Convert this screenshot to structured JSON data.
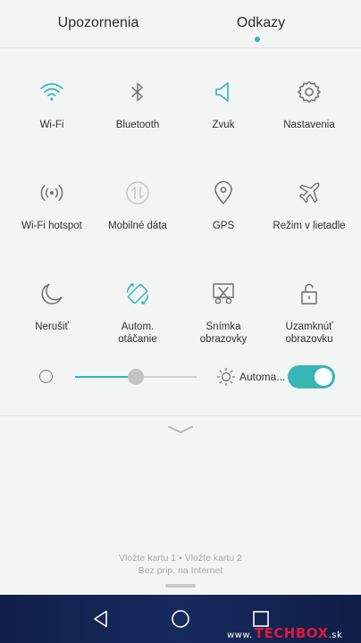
{
  "tabs": {
    "notifications": "Upozornenia",
    "shortcuts": "Odkazy",
    "active_indicator_color": "#2eb8b8"
  },
  "toggles": [
    {
      "label": "Wi-Fi",
      "icon": "wifi-icon",
      "active": true
    },
    {
      "label": "Bluetooth",
      "icon": "bluetooth-icon",
      "active": false
    },
    {
      "label": "Zvuk",
      "icon": "speaker-icon",
      "active": true
    },
    {
      "label": "Nastavenia",
      "icon": "gear-icon",
      "active": false
    },
    {
      "label": "Wi-Fi hotspot",
      "icon": "hotspot-icon",
      "active": false
    },
    {
      "label": "Mobilné dáta",
      "icon": "mobile-data-icon",
      "active": false,
      "disabled": true
    },
    {
      "label": "GPS",
      "icon": "location-pin-icon",
      "active": false
    },
    {
      "label": "Režim v lietadle",
      "icon": "airplane-icon",
      "active": false
    },
    {
      "label": "Nerušiť",
      "icon": "moon-icon",
      "active": false
    },
    {
      "label": "Autom.\notáčanie",
      "label_line1": "Autom.",
      "label_line2": "otáčanie",
      "icon": "auto-rotate-icon",
      "active": true
    },
    {
      "label": "Snímka obrazovky",
      "label_line1": "Snímka",
      "label_line2": "obrazovky",
      "icon": "screenshot-icon",
      "active": false
    },
    {
      "label": "Uzamknúť obrazovku",
      "label_line1": "Uzamknúť",
      "label_line2": "obrazovku",
      "icon": "lock-icon",
      "active": false
    }
  ],
  "brightness": {
    "level": 0.5,
    "auto_label": "Automa...",
    "auto_enabled": true
  },
  "sim_status": {
    "line1": "Vložte kartu 1 • Vložte kartu 2",
    "line2": "Bez prip. na Internet"
  },
  "navbar": {
    "back": "back-icon",
    "home": "home-icon",
    "recent": "recent-apps-icon"
  },
  "watermark": {
    "prefix": "www.",
    "tech": "TECH",
    "box": "BOX",
    "suffix": ".sk"
  },
  "colors": {
    "accent": "#2eb8b8",
    "icon_gray": "#6f6f6f",
    "navbar": "#14255a",
    "watermark_red": "#e0193a"
  }
}
